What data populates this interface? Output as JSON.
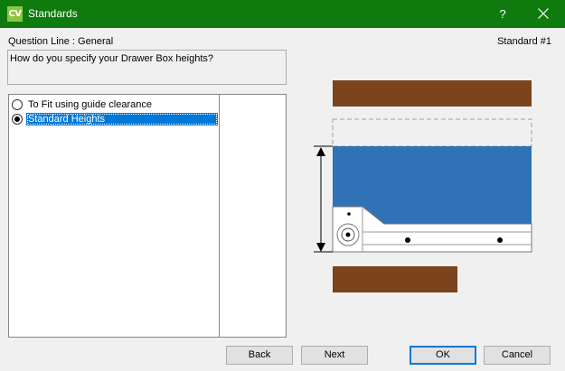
{
  "window": {
    "title": "Standards",
    "app_icon_text": "CV",
    "help_label": "?"
  },
  "header": {
    "question_line": "Question Line : General",
    "standard_number": "Standard #1"
  },
  "question": {
    "text": "How do you specify your Drawer Box heights?"
  },
  "options": [
    {
      "label": "To Fit using guide clearance",
      "selected": false
    },
    {
      "label": "Standard Heights",
      "selected": true
    }
  ],
  "buttons": {
    "back": "Back",
    "next": "Next",
    "ok": "OK",
    "cancel": "Cancel"
  },
  "colors": {
    "titlebar": "#0f7b0f",
    "selection": "#0078d7",
    "drawer_box": "#2f72b6",
    "wood": "#7b441c"
  }
}
